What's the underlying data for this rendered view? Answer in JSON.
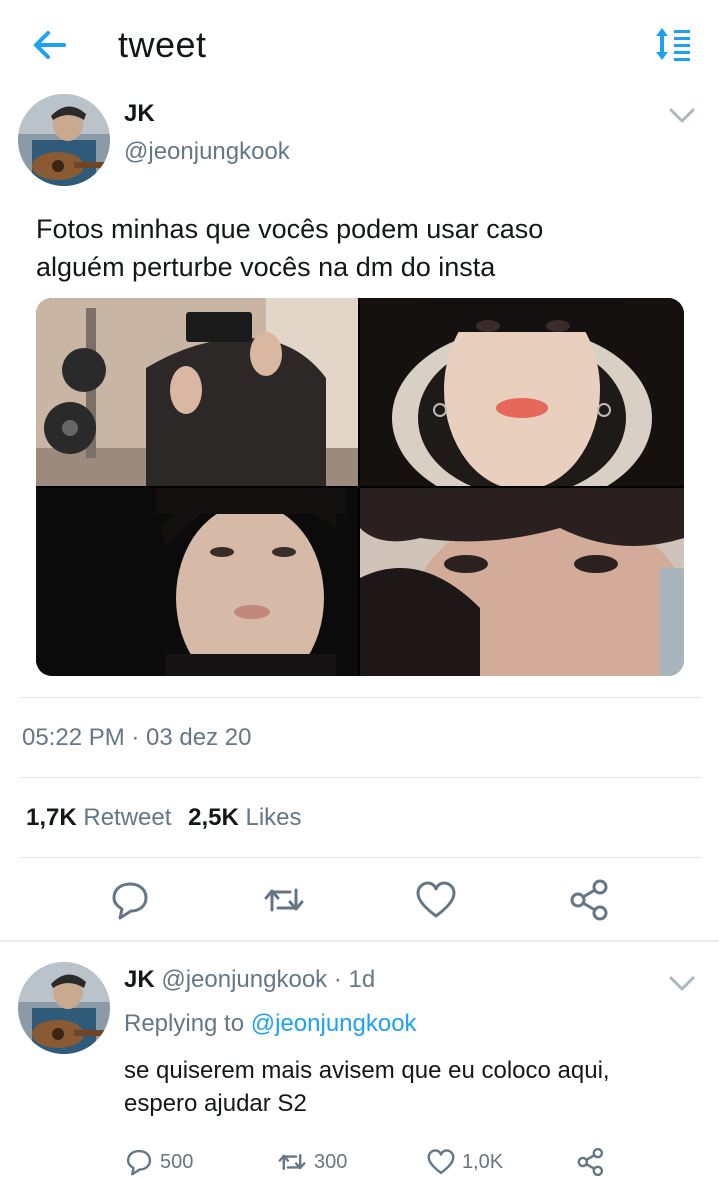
{
  "header": {
    "title": "tweet",
    "back_icon": "arrow-left-icon",
    "sort_icon": "sort-list-icon"
  },
  "colors": {
    "accent": "#1da1f2",
    "text": "#14171a",
    "secondary": "#657786",
    "divider": "#e1e8ed"
  },
  "tweet": {
    "name": "JK",
    "handle": "@jeonjungkook",
    "text_line1": "Fotos minhas que vocês podem usar caso",
    "text_line2": "alguém perturbe vocês na dm do insta",
    "timestamp": "05:22 PM · 03 dez 20",
    "retweets_count": "1,7K",
    "retweets_label": "Retweet",
    "likes_count": "2,5K",
    "likes_label": "Likes",
    "actions": [
      "reply-icon",
      "retweet-icon",
      "heart-icon",
      "share-icon"
    ]
  },
  "reply": {
    "name": "JK",
    "handle_time": "@jeonjungkook · 1d",
    "replying_prefix": "Replying to",
    "replying_to": "@jeonjungkook",
    "text_line1": "se quiserem mais avisem que eu coloco aqui,",
    "text_line2": "espero ajudar S2",
    "reply_count": "500",
    "retweet_count": "300",
    "like_count": "1,0K"
  }
}
